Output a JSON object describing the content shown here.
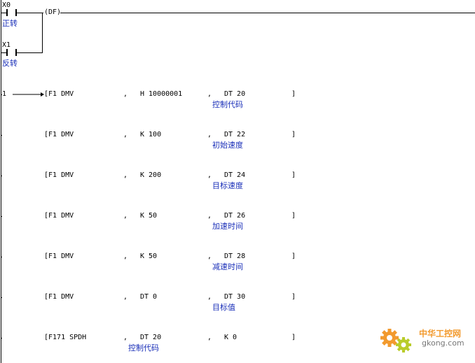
{
  "header": {
    "contact1": {
      "address": "X0",
      "comment": "正转"
    },
    "contact2": {
      "address": "X1",
      "comment": "反转"
    },
    "output": "(DF)"
  },
  "branch_label": "1",
  "rows": [
    {
      "instr": "[F1 DMV",
      "sep1": ",",
      "op1": "H 10000001",
      "op1_comment": "",
      "sep2": ",",
      "op2": "DT 20",
      "op2_comment": "控制代码",
      "end": "]"
    },
    {
      "instr": "[F1 DMV",
      "sep1": ",",
      "op1": "K 100",
      "op1_comment": "",
      "sep2": ",",
      "op2": "DT 22",
      "op2_comment": "初始速度",
      "end": "]"
    },
    {
      "instr": "[F1 DMV",
      "sep1": ",",
      "op1": "K 200",
      "op1_comment": "",
      "sep2": ",",
      "op2": "DT 24",
      "op2_comment": "目标速度",
      "end": "]"
    },
    {
      "instr": "[F1 DMV",
      "sep1": ",",
      "op1": "K 50",
      "op1_comment": "",
      "sep2": ",",
      "op2": "DT 26",
      "op2_comment": "加速时间",
      "end": "]"
    },
    {
      "instr": "[F1 DMV",
      "sep1": ",",
      "op1": "K 50",
      "op1_comment": "",
      "sep2": ",",
      "op2": "DT 28",
      "op2_comment": "减速时间",
      "end": "]"
    },
    {
      "instr": "[F1 DMV",
      "sep1": ",",
      "op1": "DT 0",
      "op1_comment": "",
      "sep2": ",",
      "op2": "DT 30",
      "op2_comment": "目标值",
      "end": "]"
    },
    {
      "instr": "[F171 SPDH",
      "sep1": ",",
      "op1": "DT 20",
      "op1_comment": "控制代码",
      "sep2": ",",
      "op2": "K 0",
      "op2_comment": "",
      "end": "]"
    }
  ],
  "watermark": {
    "brand": "中华工控网",
    "domain": "gkong.com"
  },
  "colors": {
    "comment": "#1a2fb8",
    "wire": "#000000",
    "gear_orange": "#f29a2e",
    "gear_green": "#b9cc2a"
  }
}
